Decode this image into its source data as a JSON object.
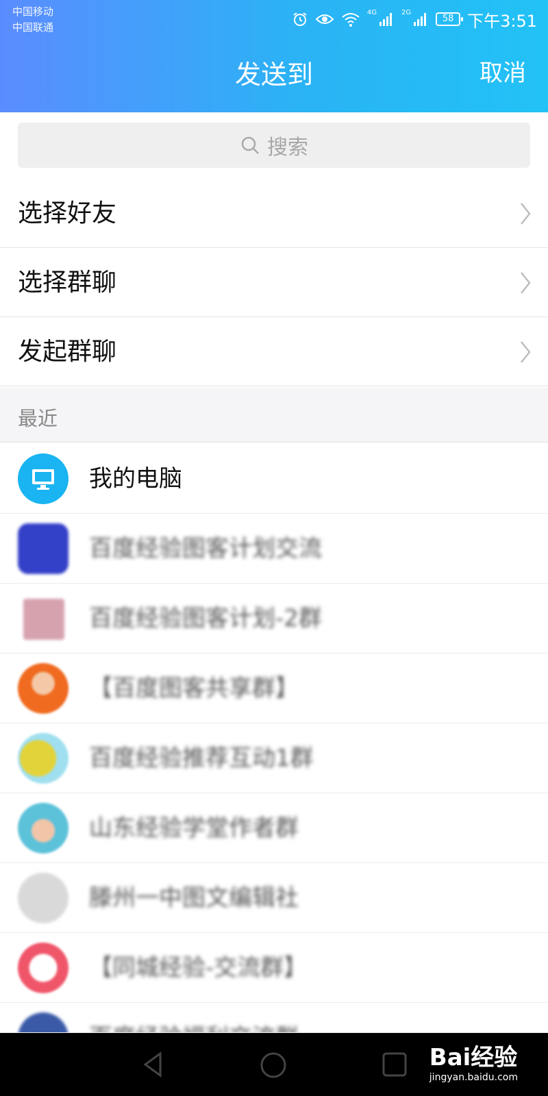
{
  "status_bar": {
    "carrier1": "中国移动",
    "carrier2": "中国联通",
    "net1": "4G",
    "net2": "2G",
    "battery": "58",
    "time": "下午3:51"
  },
  "header": {
    "title": "发送到",
    "cancel": "取消"
  },
  "search": {
    "placeholder": "搜索"
  },
  "menu": [
    {
      "label": "选择好友"
    },
    {
      "label": "选择群聊"
    },
    {
      "label": "发起群聊"
    }
  ],
  "recent": {
    "section_label": "最近",
    "items": [
      {
        "name": "我的电脑",
        "avatar": "computer-icon",
        "color": "#19b4f1"
      },
      {
        "name": "百度经验图客计划交流",
        "avatar": "group-avatar",
        "color": "#3340c8"
      },
      {
        "name": "百度经验图客计划-2群",
        "avatar": "group-avatar",
        "color": "#d6a2ae"
      },
      {
        "name": "【百度图客共享群】",
        "avatar": "group-avatar",
        "color": "#f06a1f"
      },
      {
        "name": "百度经验推荐互动1群",
        "avatar": "group-avatar",
        "color": "#e3d33a"
      },
      {
        "name": "山东经验学堂作者群",
        "avatar": "group-avatar",
        "color": "#5cc2da"
      },
      {
        "name": "滕州一中图文编辑社",
        "avatar": "group-avatar",
        "color": "#d9d9d9"
      },
      {
        "name": "【同城经验-交流群】",
        "avatar": "group-avatar",
        "color": "#f0566a"
      },
      {
        "name": "百度经验福利交流群",
        "avatar": "group-avatar",
        "color": "#3a5aa8"
      }
    ]
  },
  "watermark": {
    "brand": "Bai经验",
    "site": "jingyan.baidu.com"
  }
}
